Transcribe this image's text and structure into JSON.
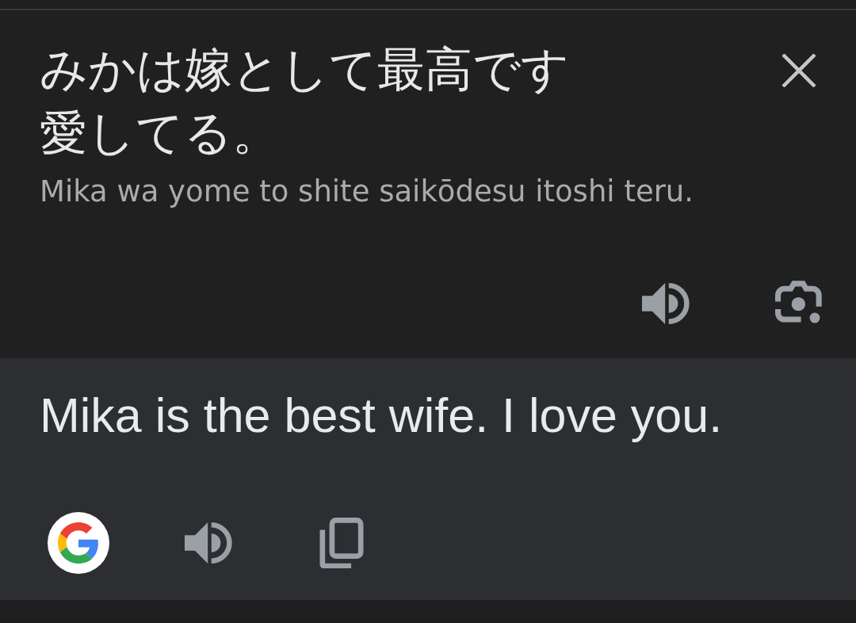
{
  "source": {
    "text": "みかは嫁として最高です愛してる。",
    "romanization": "Mika wa yome to shite saikōdesu itoshi teru."
  },
  "translation": {
    "text": "Mika is the best wife. I love you."
  }
}
